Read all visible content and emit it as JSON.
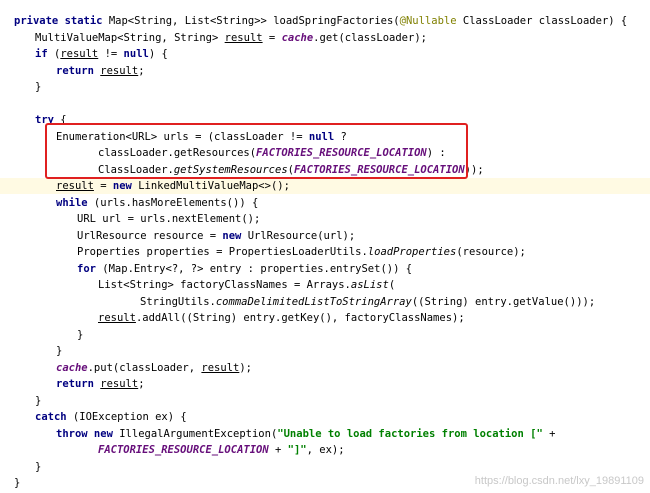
{
  "editor": {
    "lines": [
      {
        "segments": [
          {
            "t": "private static",
            "c": "kw"
          },
          {
            "t": " Map<String, List<String>> loadSpringFactories("
          },
          {
            "t": "@Nullable",
            "c": "ann"
          },
          {
            "t": " ClassLoader classLoader) {"
          }
        ]
      },
      {
        "segments": [
          {
            "t": "MultiValueMap<String, String> "
          },
          {
            "t": "result",
            "c": "ul"
          },
          {
            "t": " = "
          },
          {
            "t": "cache",
            "c": "field"
          },
          {
            "t": ".get(classLoader);"
          }
        ]
      },
      {
        "segments": [
          {
            "t": "if",
            "c": "kw"
          },
          {
            "t": " ("
          },
          {
            "t": "result",
            "c": "ul"
          },
          {
            "t": " != "
          },
          {
            "t": "null",
            "c": "kw"
          },
          {
            "t": ") {"
          }
        ]
      },
      {
        "segments": [
          {
            "t": "return",
            "c": "kw"
          },
          {
            "t": " "
          },
          {
            "t": "result",
            "c": "ul"
          },
          {
            "t": ";"
          }
        ]
      },
      {
        "segments": [
          {
            "t": "}"
          }
        ]
      },
      {
        "segments": []
      },
      {
        "segments": [
          {
            "t": "try",
            "c": "kw"
          },
          {
            "t": " {"
          }
        ]
      },
      {
        "segments": [
          {
            "t": "Enumeration<URL> urls = (classLoader != "
          },
          {
            "t": "null",
            "c": "kw"
          },
          {
            "t": " ?"
          }
        ]
      },
      {
        "segments": [
          {
            "t": "classLoader.getResources("
          },
          {
            "t": "FACTORIES_RESOURCE_LOCATION",
            "c": "field"
          },
          {
            "t": ") :"
          }
        ]
      },
      {
        "segments": [
          {
            "t": "ClassLoader."
          },
          {
            "t": "getSystemResources",
            "c": "static-m"
          },
          {
            "t": "("
          },
          {
            "t": "FACTORIES_RESOURCE_LOCATION",
            "c": "field"
          },
          {
            "t": "));"
          }
        ]
      },
      {
        "segments": [
          {
            "t": "result",
            "c": "ul"
          },
          {
            "t": " = "
          },
          {
            "t": "new",
            "c": "kw"
          },
          {
            "t": " LinkedMultiValueMap<>();"
          }
        ]
      },
      {
        "segments": [
          {
            "t": "while",
            "c": "kw"
          },
          {
            "t": " (urls.hasMoreElements()) {"
          }
        ]
      },
      {
        "segments": [
          {
            "t": "URL url = urls.nextElement();"
          }
        ]
      },
      {
        "segments": [
          {
            "t": "UrlResource resource = "
          },
          {
            "t": "new",
            "c": "kw"
          },
          {
            "t": " UrlResource(url);"
          }
        ]
      },
      {
        "segments": [
          {
            "t": "Properties properties = PropertiesLoaderUtils."
          },
          {
            "t": "loadProperties",
            "c": "static-m"
          },
          {
            "t": "(resource);"
          }
        ]
      },
      {
        "segments": [
          {
            "t": "for",
            "c": "kw"
          },
          {
            "t": " (Map.Entry<?, ?> entry : properties.entrySet()) {"
          }
        ]
      },
      {
        "segments": [
          {
            "t": "List<String> factoryClassNames = Arrays."
          },
          {
            "t": "asList",
            "c": "static-m"
          },
          {
            "t": "("
          }
        ]
      },
      {
        "segments": [
          {
            "t": "StringUtils."
          },
          {
            "t": "commaDelimitedListToStringArray",
            "c": "static-m"
          },
          {
            "t": "((String) entry.getValue()));"
          }
        ]
      },
      {
        "segments": [
          {
            "t": "result",
            "c": "ul"
          },
          {
            "t": ".addAll((String) entry.getKey(), factoryClassNames);"
          }
        ]
      },
      {
        "segments": [
          {
            "t": "}"
          }
        ]
      },
      {
        "segments": [
          {
            "t": "}"
          }
        ]
      },
      {
        "segments": [
          {
            "t": "cache",
            "c": "field"
          },
          {
            "t": ".put(classLoader, "
          },
          {
            "t": "result",
            "c": "ul"
          },
          {
            "t": ");"
          }
        ]
      },
      {
        "segments": [
          {
            "t": "return",
            "c": "kw"
          },
          {
            "t": " "
          },
          {
            "t": "result",
            "c": "ul"
          },
          {
            "t": ";"
          }
        ]
      },
      {
        "segments": [
          {
            "t": "}"
          }
        ]
      },
      {
        "segments": [
          {
            "t": "catch",
            "c": "kw"
          },
          {
            "t": " (IOException ex) {"
          }
        ]
      },
      {
        "segments": [
          {
            "t": "throw new",
            "c": "kw"
          },
          {
            "t": " IllegalArgumentException("
          },
          {
            "t": "\"Unable to load factories from location [\"",
            "c": "str"
          },
          {
            "t": " +"
          }
        ]
      },
      {
        "segments": [
          {
            "t": "FACTORIES_RESOURCE_LOCATION",
            "c": "field"
          },
          {
            "t": " + "
          },
          {
            "t": "\"]\"",
            "c": "str"
          },
          {
            "t": ", ex);"
          }
        ]
      },
      {
        "segments": [
          {
            "t": "}"
          }
        ]
      },
      {
        "segments": [
          {
            "t": "}"
          }
        ]
      }
    ]
  },
  "watermark": "https://blog.csdn.net/lxy_19891109"
}
